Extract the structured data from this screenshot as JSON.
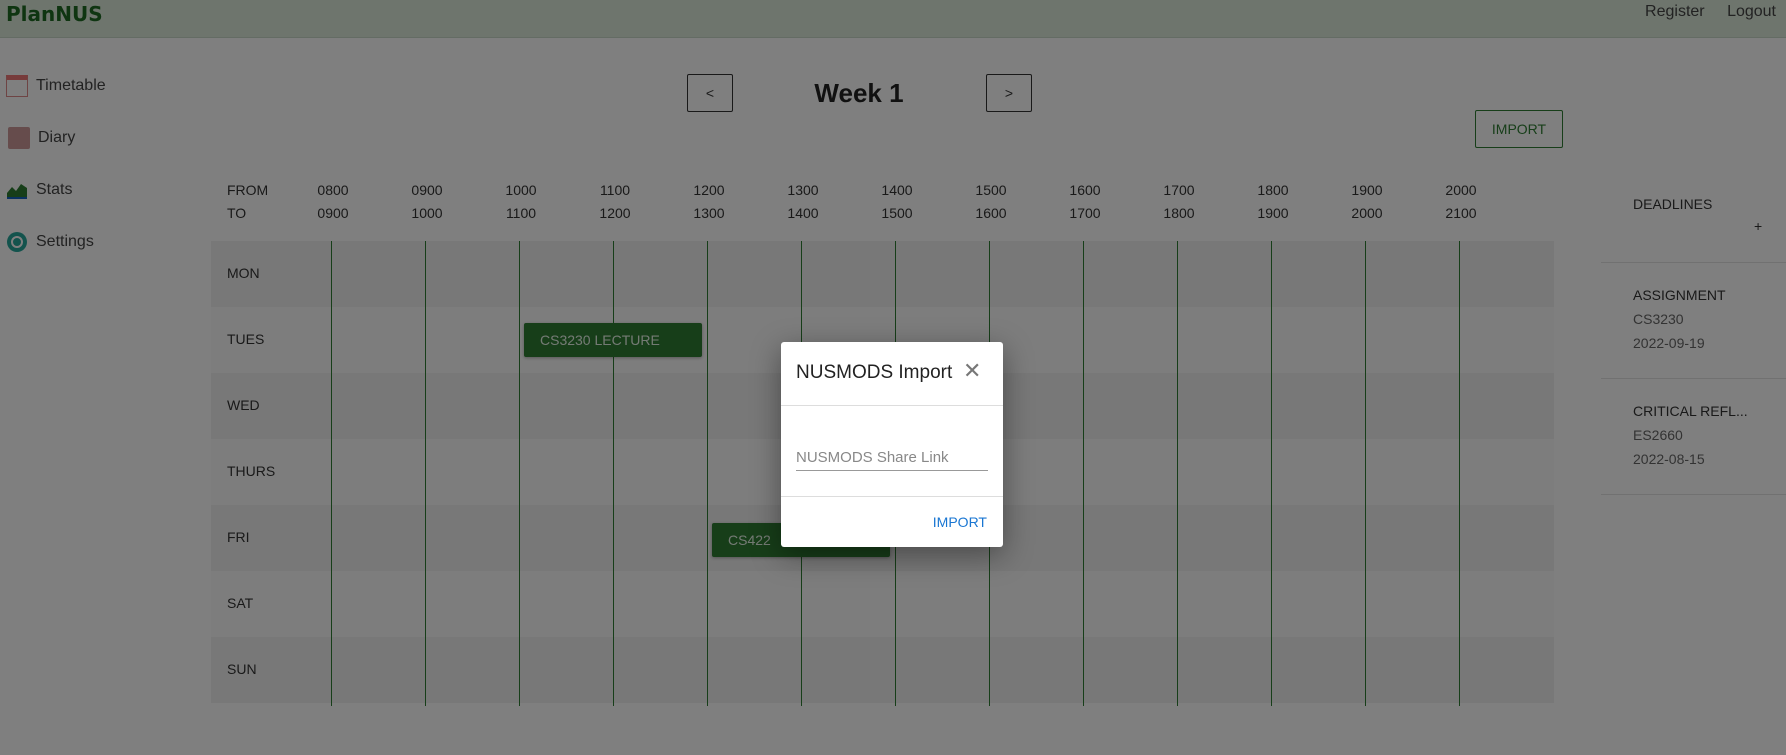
{
  "app": {
    "brand": "PlanNUS"
  },
  "nav": {
    "register": "Register",
    "logout": "Logout"
  },
  "sidebar": {
    "items": [
      {
        "label": "Timetable",
        "icon": "calendar-icon"
      },
      {
        "label": "Diary",
        "icon": "diary-icon"
      },
      {
        "label": "Stats",
        "icon": "stats-icon"
      },
      {
        "label": "Settings",
        "icon": "gear-icon"
      }
    ]
  },
  "week": {
    "prev": "<",
    "title": "Week 1",
    "next": ">",
    "import": "IMPORT"
  },
  "timetable": {
    "from_label": "FROM",
    "to_label": "TO",
    "slots": [
      {
        "from": "0800",
        "to": "0900"
      },
      {
        "from": "0900",
        "to": "1000"
      },
      {
        "from": "1000",
        "to": "1100"
      },
      {
        "from": "1100",
        "to": "1200"
      },
      {
        "from": "1200",
        "to": "1300"
      },
      {
        "from": "1300",
        "to": "1400"
      },
      {
        "from": "1400",
        "to": "1500"
      },
      {
        "from": "1500",
        "to": "1600"
      },
      {
        "from": "1600",
        "to": "1700"
      },
      {
        "from": "1700",
        "to": "1800"
      },
      {
        "from": "1800",
        "to": "1900"
      },
      {
        "from": "1900",
        "to": "2000"
      },
      {
        "from": "2000",
        "to": "2100"
      }
    ],
    "days": [
      "MON",
      "TUES",
      "WED",
      "THURS",
      "FRI",
      "SAT",
      "SUN"
    ],
    "events": [
      {
        "label": "CS3230 LECTURE",
        "day": "TUES",
        "start": "1000",
        "end": "1200"
      },
      {
        "label": "CS422",
        "day": "FRI",
        "start": "1200",
        "end": "1400"
      }
    ]
  },
  "deadlines": {
    "title": "DEADLINES",
    "add": "+",
    "items": [
      {
        "title": "ASSIGNMENT",
        "module": "CS3230",
        "date": "2022-09-19"
      },
      {
        "title": "CRITICAL REFL...",
        "module": "ES2660",
        "date": "2022-08-15"
      }
    ]
  },
  "modal": {
    "title": "NUSMODS Import",
    "close": "✕",
    "input_placeholder": "NUSMODS Share Link",
    "input_value": "",
    "import": "IMPORT"
  },
  "colors": {
    "accent": "#2e7d32",
    "topbar": "#dceadb",
    "link": "#1976d2"
  }
}
